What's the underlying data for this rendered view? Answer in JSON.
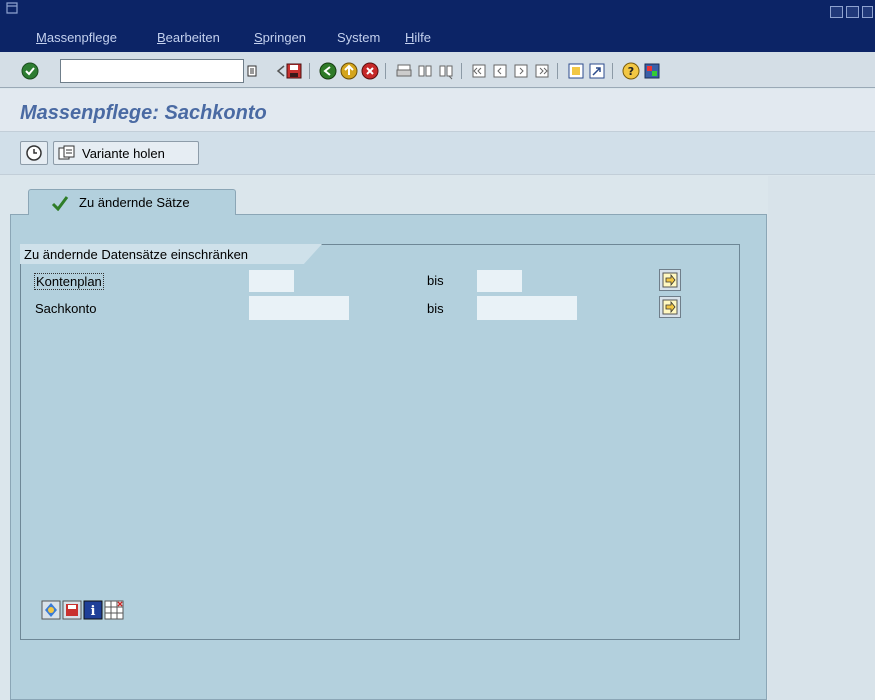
{
  "window": {
    "menu": [
      {
        "first": "M",
        "rest": "assenpflege"
      },
      {
        "first": "B",
        "rest": "earbeiten"
      },
      {
        "first": "S",
        "rest": "pringen"
      },
      {
        "first": "",
        "rest": "System"
      },
      {
        "first": "H",
        "rest": "ilfe"
      }
    ]
  },
  "toolbar": {
    "command_field_value": "",
    "icons": [
      "enter-icon",
      "command-field-dropdown-icon",
      "back-arrow-icon",
      "save-icon",
      "back-icon",
      "exit-icon",
      "cancel-icon",
      "print-icon",
      "find-icon",
      "find-next-icon",
      "first-page-icon",
      "previous-page-icon",
      "next-page-icon",
      "last-page-icon",
      "create-session-icon",
      "shortcut-icon",
      "help-icon",
      "layout-menu-icon"
    ]
  },
  "page": {
    "title": "Massenpflege: Sachkonto"
  },
  "app_toolbar": {
    "variant_button_label": "Variante holen"
  },
  "tab": {
    "label": "Zu ändernde Sätze"
  },
  "group": {
    "caption": "Zu ändernde Datensätze einschränken"
  },
  "fields": [
    {
      "label": "Kontenplan",
      "from_value": "",
      "bis_label": "bis",
      "to_value": ""
    },
    {
      "label": "Sachkonto",
      "from_value": "",
      "bis_label": "bis",
      "to_value": ""
    }
  ],
  "colors": {
    "title_bar": "#0c2466",
    "title_text": "#4a6aa3",
    "tab_panel": "#b3d0dd"
  }
}
